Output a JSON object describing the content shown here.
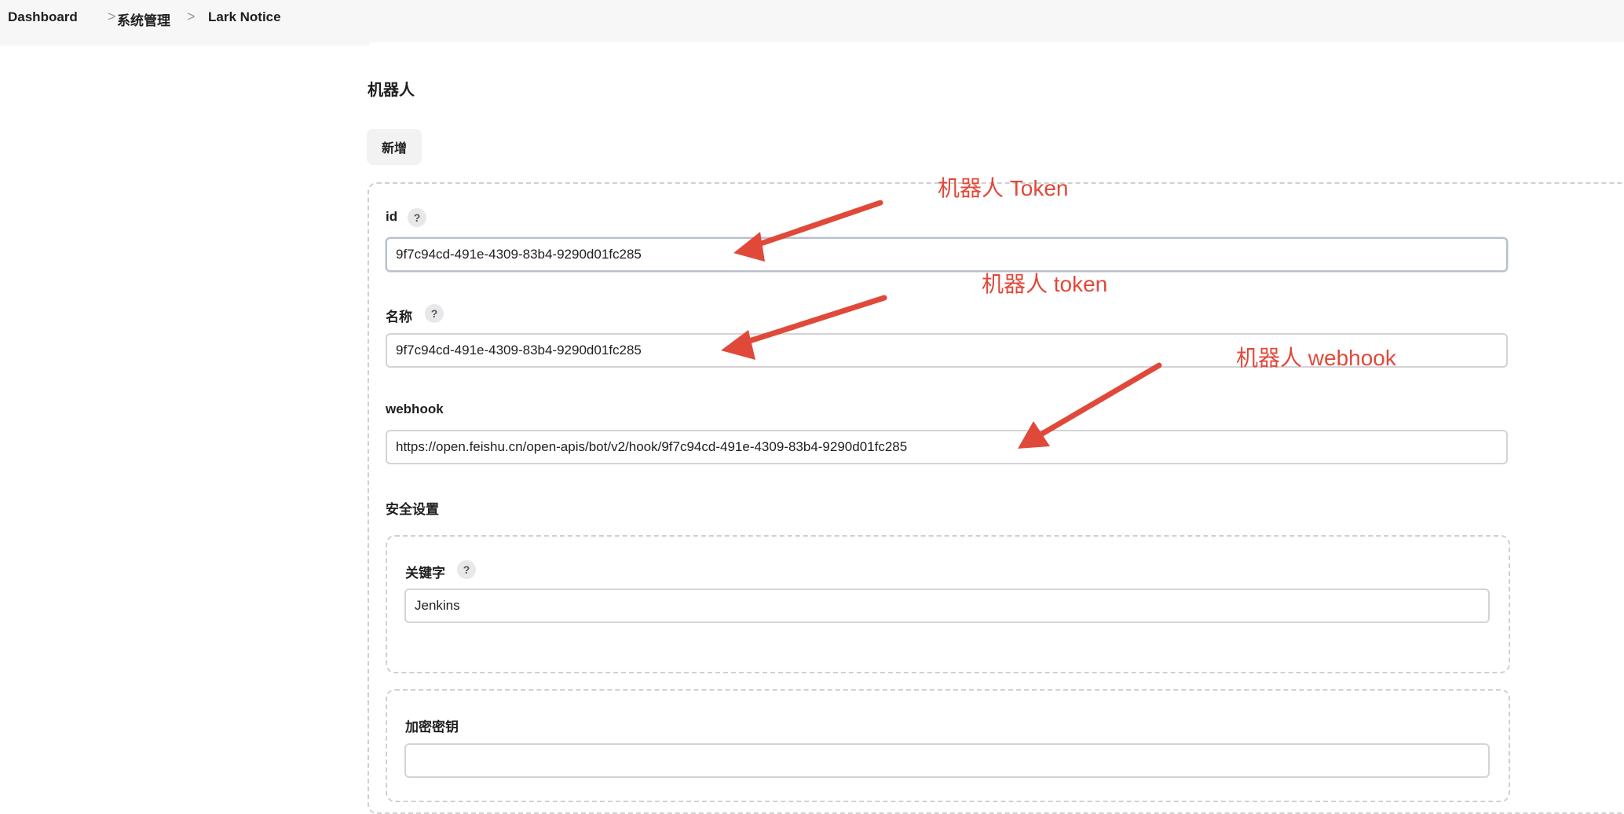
{
  "breadcrumb": {
    "items": [
      {
        "label": "Dashboard"
      },
      {
        "label": "系统管理"
      },
      {
        "label": "Lark Notice"
      }
    ],
    "separator": ">"
  },
  "section": {
    "title": "机器人",
    "add_button": "新增"
  },
  "form": {
    "id": {
      "label": "id",
      "help": "?",
      "value": "9f7c94cd-491e-4309-83b4-9290d01fc285"
    },
    "name": {
      "label": "名称",
      "help": "?",
      "value": "9f7c94cd-491e-4309-83b4-9290d01fc285"
    },
    "webhook": {
      "label": "webhook",
      "value": "https://open.feishu.cn/open-apis/bot/v2/hook/9f7c94cd-491e-4309-83b4-9290d01fc285"
    },
    "security": {
      "title": "安全设置",
      "keyword": {
        "label": "关键字",
        "help": "?",
        "value": "Jenkins"
      },
      "secret": {
        "label": "加密密钥",
        "value": ""
      }
    }
  },
  "annotations": {
    "token_upper": "机器人 Token",
    "token_lower": "机器人 token",
    "webhook": "机器人 webhook",
    "color": "#e0493a"
  }
}
